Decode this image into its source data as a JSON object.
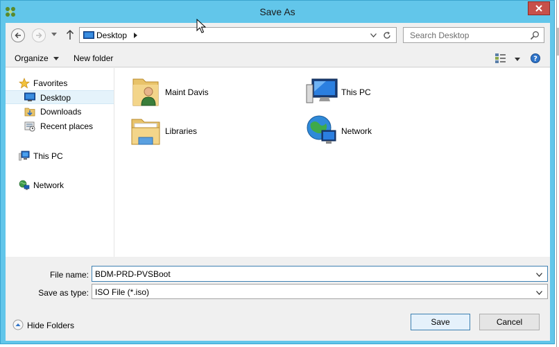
{
  "window": {
    "title": "Save As"
  },
  "address_bar": {
    "location": "Desktop",
    "search_placeholder": "Search Desktop"
  },
  "toolbar": {
    "organize_label": "Organize",
    "new_folder_label": "New folder"
  },
  "nav_pane": {
    "items": [
      {
        "label": "Favorites",
        "icon": "star-icon"
      },
      {
        "label": "Desktop",
        "icon": "desktop-icon",
        "selected": true
      },
      {
        "label": "Downloads",
        "icon": "downloads-icon"
      },
      {
        "label": "Recent places",
        "icon": "recent-places-icon"
      },
      {
        "label": "This PC",
        "icon": "computer-icon"
      },
      {
        "label": "Network",
        "icon": "network-icon"
      }
    ]
  },
  "content": {
    "items": [
      {
        "label": "Maint Davis",
        "icon": "user-folder-icon"
      },
      {
        "label": "This PC",
        "icon": "computer-icon"
      },
      {
        "label": "Libraries",
        "icon": "libraries-icon"
      },
      {
        "label": "Network",
        "icon": "network-globe-icon"
      }
    ]
  },
  "form": {
    "file_name_label": "File name:",
    "file_name_value": "BDM-PRD-PVSBoot",
    "save_type_label": "Save as type:",
    "save_type_value": "ISO File (*.iso)"
  },
  "footer": {
    "hide_folders_label": "Hide Folders",
    "save_label": "Save",
    "cancel_label": "Cancel"
  },
  "colors": {
    "frame": "#62c6ea",
    "close_button": "#c7504a",
    "selection": "#e5f3fb",
    "focus_border": "#3c7fb1"
  }
}
